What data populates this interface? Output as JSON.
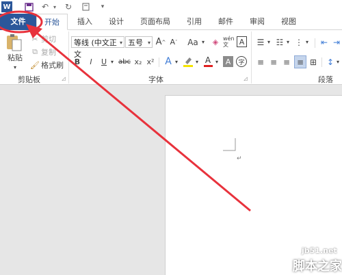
{
  "quick_access": {
    "word_icon": "W",
    "save_icon": "save-icon",
    "undo_icon": "undo-icon",
    "redo_icon": "redo-icon",
    "touch_icon": "touch-mode-icon",
    "customize_icon": "customize-icon"
  },
  "tabs": [
    "文件",
    "开始",
    "插入",
    "设计",
    "页面布局",
    "引用",
    "邮件",
    "审阅",
    "视图"
  ],
  "clipboard": {
    "paste": "粘贴",
    "cut": "剪切",
    "copy": "复制",
    "format_painter": "格式刷",
    "group_label": "剪贴板"
  },
  "font": {
    "font_name": "等线 (中文正文",
    "font_size": "五号",
    "grow": "A",
    "shrink": "A",
    "case": "Aa",
    "bold": "B",
    "italic": "I",
    "underline": "U",
    "strike": "abc",
    "subscript": "x₂",
    "superscript": "x²",
    "char_border": "A",
    "char_shading": "A",
    "phonetic": "wén 文",
    "enclose": "字",
    "group_label": "字体"
  },
  "paragraph": {
    "group_label": "段落"
  },
  "watermark": {
    "url": "jb51.net",
    "name": "脚本之家"
  },
  "colors": {
    "file_tab": "#2b579a",
    "annotation": "#e8323c"
  }
}
